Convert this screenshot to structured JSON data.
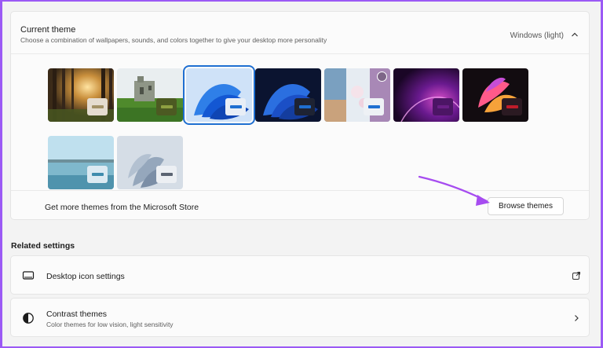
{
  "theme": {
    "title": "Current theme",
    "subtitle": "Choose a combination of wallpapers, sounds, and colors together to give your desktop more personality",
    "current": "Windows (light)",
    "store_label": "Get more themes from the Microsoft Store",
    "browse_label": "Browse themes",
    "thumbnails": [
      {
        "name": "forest-sunrise",
        "swatch_bg": "#e5dccf",
        "swatch_bar": "#a39166",
        "selected": false
      },
      {
        "name": "castle-ruins",
        "swatch_bg": "#4c5a22",
        "swatch_bar": "#8ea041",
        "selected": false
      },
      {
        "name": "windows-light-bloom",
        "swatch_bg": "#e8eef6",
        "swatch_bar": "#1f6fd1",
        "selected": true
      },
      {
        "name": "windows-dark-bloom",
        "swatch_bg": "#1e2333",
        "swatch_bar": "#1f6fd1",
        "selected": false
      },
      {
        "name": "flowers-beach",
        "swatch_bg": "#eef1f5",
        "swatch_bar": "#1f6fd1",
        "selected": false
      },
      {
        "name": "glow-purple",
        "swatch_bg": "#4c1565",
        "swatch_bar": "#6a1f86",
        "selected": false
      },
      {
        "name": "captured-motion",
        "swatch_bg": "#2b1a22",
        "swatch_bar": "#c01c2a",
        "selected": false
      },
      {
        "name": "sunrise-lake",
        "swatch_bg": "#dceaf2",
        "swatch_bar": "#3f8cad",
        "selected": false
      },
      {
        "name": "flow-gray",
        "swatch_bg": "#eceff3",
        "swatch_bar": "#5b6472",
        "selected": false
      }
    ]
  },
  "related": {
    "title": "Related settings",
    "desktop_icons": {
      "label": "Desktop icon settings"
    },
    "contrast": {
      "label": "Contrast themes",
      "sub": "Color themes for low vision, light sensitivity"
    }
  },
  "colors": {
    "accent": "#1f6fd1",
    "annotation_arrow": "#a64cf0"
  }
}
